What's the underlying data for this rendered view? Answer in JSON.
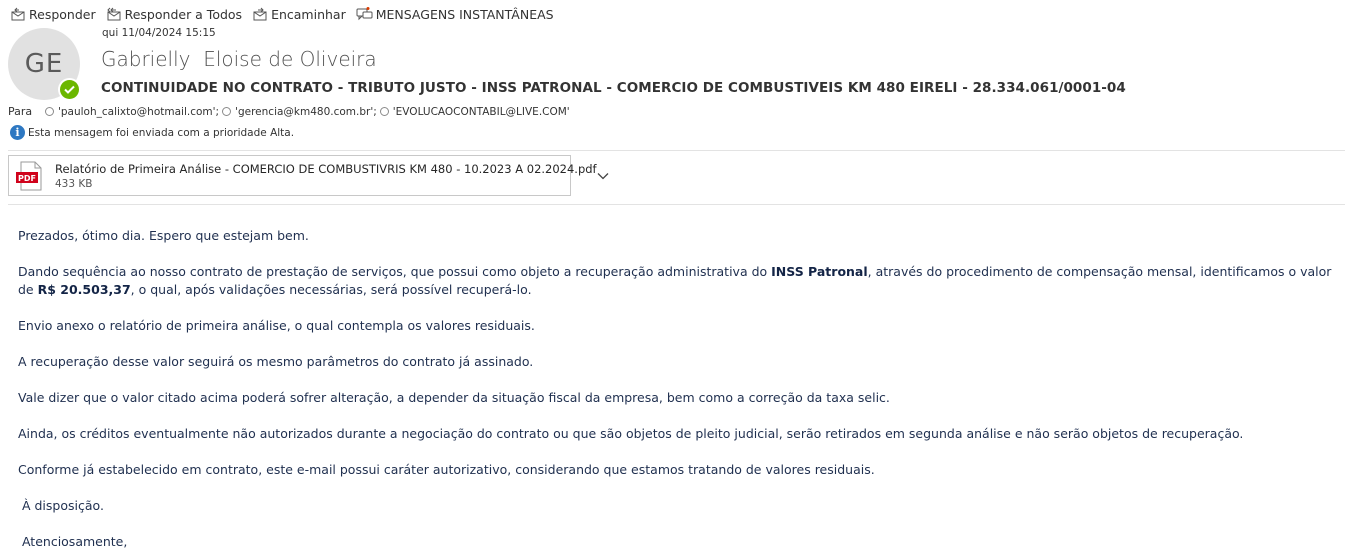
{
  "toolbar": {
    "reply": "Responder",
    "reply_all": "Responder a Todos",
    "forward": "Encaminhar",
    "im": "MENSAGENS INSTANTÂNEAS"
  },
  "message": {
    "avatar_initials": "GE",
    "date": "qui 11/04/2024 15:15",
    "sender": "Gabrielly  Eloise de Oliveira",
    "subject": "CONTINUIDADE NO CONTRATO - TRIBUTO JUSTO - INSS PATRONAL - COMERCIO DE COMBUSTIVEIS KM 480 EIRELI - 28.334.061/0001-04",
    "to_label": "Para",
    "recipients": [
      "'pauloh_calixto@hotmail.com';",
      "'gerencia@km480.com.br';",
      "'EVOLUCAOCONTABIL@LIVE.COM'"
    ],
    "priority_note": "Esta mensagem foi enviada com a prioridade Alta."
  },
  "attachment": {
    "icon_label": "PDF",
    "name": "Relatório de Primeira Análise - COMERCIO DE COMBUSTIVRIS KM 480 - 10.2023 A 02.2024.pdf",
    "size": "433 KB"
  },
  "body": {
    "p1": "Prezados, ótimo dia. Espero que estejam bem.",
    "p2_a": "Dando sequência ao nosso contrato de prestação de serviços, que possui como objeto a recuperação administrativa do ",
    "p2_bold1": "INSS Patronal",
    "p2_b": ", através do procedimento de compensação mensal, identificamos o valor de ",
    "p2_bold2": "R$ 20.503,37",
    "p2_c": ", o qual, após validações necessárias, será possível recuperá-lo.",
    "p3": "Envio anexo o relatório de primeira análise, o qual contempla os valores residuais.",
    "p4": "A recuperação desse valor seguirá os mesmo parâmetros do contrato já assinado.",
    "p5": "Vale dizer que o valor citado acima poderá sofrer alteração, a depender da situação fiscal da empresa, bem como a correção da taxa selic.",
    "p6": "Ainda, os créditos eventualmente não autorizados durante a negociação do contrato ou que são objetos de pleito judicial, serão retirados em segunda análise e não serão objetos de recuperação.",
    "p7": "Conforme já estabelecido em contrato, este e-mail possui caráter autorizativo, considerando que estamos tratando de valores residuais.",
    "p8": " À disposição.",
    "p9": " Atenciosamente,"
  },
  "colors": {
    "presence": "#6bb700",
    "info": "#2e78c2",
    "pdf_red": "#d0021b",
    "body_text": "#1f2f4f"
  }
}
